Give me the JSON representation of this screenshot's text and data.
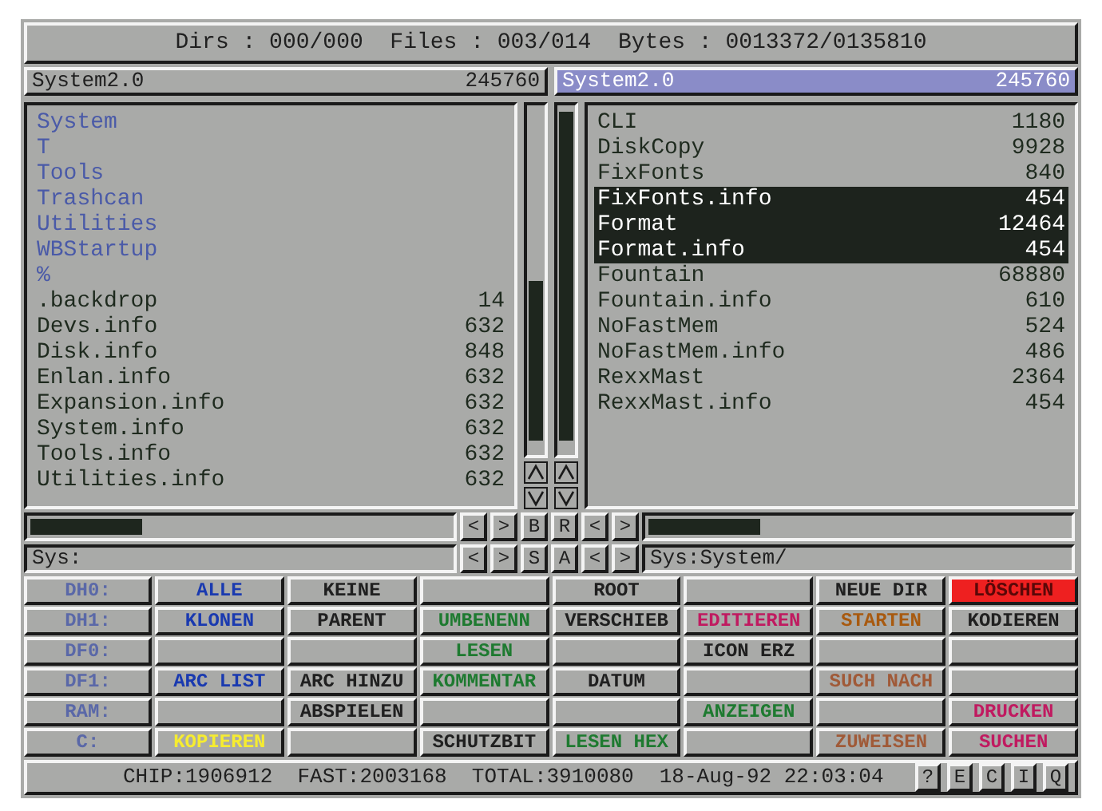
{
  "title_bar": "Dirs : 000/000  Files : 003/014  Bytes : 0013372/0135810",
  "panels": [
    {
      "title": "System2.0",
      "size": "245760",
      "active": false,
      "path": "Sys:",
      "entries": [
        {
          "name": "System",
          "kind": "dir",
          "selected": false
        },
        {
          "name": "T",
          "kind": "dir",
          "selected": false
        },
        {
          "name": "Tools",
          "kind": "dir",
          "selected": false
        },
        {
          "name": "Trashcan",
          "kind": "dir",
          "selected": false
        },
        {
          "name": "Utilities",
          "kind": "dir",
          "selected": false
        },
        {
          "name": "WBStartup",
          "kind": "dir",
          "selected": false
        },
        {
          "name": "%",
          "kind": "dir",
          "selected": false
        },
        {
          "name": ".backdrop",
          "size": "14",
          "kind": "file",
          "selected": false
        },
        {
          "name": "Devs.info",
          "size": "632",
          "kind": "file",
          "selected": false
        },
        {
          "name": "Disk.info",
          "size": "848",
          "kind": "file",
          "selected": false
        },
        {
          "name": "Enlan.info",
          "size": "632",
          "kind": "file",
          "selected": false
        },
        {
          "name": "Expansion.info",
          "size": "632",
          "kind": "file",
          "selected": false
        },
        {
          "name": "System.info",
          "size": "632",
          "kind": "file",
          "selected": false
        },
        {
          "name": "Tools.info",
          "size": "632",
          "kind": "file",
          "selected": false
        },
        {
          "name": "Utilities.info",
          "size": "632",
          "kind": "file",
          "selected": false
        }
      ]
    },
    {
      "title": "System2.0",
      "size": "245760",
      "active": true,
      "path": "Sys:System/",
      "entries": [
        {
          "name": "CLI",
          "size": "1180",
          "kind": "file",
          "selected": false
        },
        {
          "name": "DiskCopy",
          "size": "9928",
          "kind": "file",
          "selected": false
        },
        {
          "name": "FixFonts",
          "size": "840",
          "kind": "file",
          "selected": false
        },
        {
          "name": "FixFonts.info",
          "size": "454",
          "kind": "file",
          "selected": true
        },
        {
          "name": "Format",
          "size": "12464",
          "kind": "file",
          "selected": true
        },
        {
          "name": "Format.info",
          "size": "454",
          "kind": "file",
          "selected": true
        },
        {
          "name": "Fountain",
          "size": "68880",
          "kind": "file",
          "selected": false
        },
        {
          "name": "Fountain.info",
          "size": "610",
          "kind": "file",
          "selected": false
        },
        {
          "name": "NoFastMem",
          "size": "524",
          "kind": "file",
          "selected": false
        },
        {
          "name": "NoFastMem.info",
          "size": "486",
          "kind": "file",
          "selected": false
        },
        {
          "name": "RexxMast",
          "size": "2364",
          "kind": "file",
          "selected": false
        },
        {
          "name": "RexxMast.info",
          "size": "454",
          "kind": "file",
          "selected": false
        }
      ]
    }
  ],
  "nav_rows": [
    [
      "<",
      ">",
      "B",
      "R",
      "<",
      ">"
    ],
    [
      "<",
      ">",
      "S",
      "A",
      "<",
      ">"
    ]
  ],
  "button_rows": [
    [
      {
        "label": "DH0:",
        "color": "#5a68a8"
      },
      {
        "label": "ALLE",
        "color": "#1a3ab0"
      },
      {
        "label": "KEINE",
        "color": "#202020"
      },
      {
        "kind": "blank"
      },
      {
        "label": "ROOT",
        "color": "#202020"
      },
      {
        "kind": "blank"
      },
      {
        "label": "NEUE DIR",
        "color": "#202020"
      },
      {
        "label": "LÖSCHEN",
        "kind": "alert",
        "color": "#ee2020"
      }
    ],
    [
      {
        "label": "DH1:",
        "color": "#5a68a8"
      },
      {
        "label": "KLONEN",
        "color": "#1a3ab0"
      },
      {
        "label": "PARENT",
        "color": "#202020"
      },
      {
        "label": "UMBENENN",
        "color": "#1e7a30"
      },
      {
        "label": "VERSCHIEB",
        "color": "#202020"
      },
      {
        "label": "EDITIEREN",
        "color": "#c01a60"
      },
      {
        "label": "STARTEN",
        "color": "#a85a10"
      },
      {
        "label": "KODIEREN",
        "color": "#202020"
      }
    ],
    [
      {
        "label": "DF0:",
        "color": "#5a68a8"
      },
      {
        "kind": "blank"
      },
      {
        "kind": "blank"
      },
      {
        "label": "LESEN",
        "color": "#1e7a30"
      },
      {
        "kind": "blank"
      },
      {
        "label": "ICON ERZ",
        "color": "#202020"
      },
      {
        "kind": "blank"
      },
      {
        "kind": "blank"
      }
    ],
    [
      {
        "label": "DF1:",
        "color": "#5a68a8"
      },
      {
        "label": "ARC LIST",
        "color": "#1a3ab0"
      },
      {
        "label": "ARC HINZU",
        "color": "#202020"
      },
      {
        "label": "KOMMENTAR",
        "color": "#1e7a30"
      },
      {
        "label": "DATUM",
        "color": "#202020"
      },
      {
        "kind": "blank"
      },
      {
        "label": "SUCH NACH",
        "color": "#a05a38"
      },
      {
        "kind": "blank"
      }
    ],
    [
      {
        "label": "RAM:",
        "color": "#5a68a8"
      },
      {
        "kind": "blank"
      },
      {
        "label": "ABSPIELEN",
        "color": "#202020"
      },
      {
        "kind": "blank"
      },
      {
        "kind": "blank"
      },
      {
        "label": "ANZEIGEN",
        "color": "#1e7a30"
      },
      {
        "kind": "blank"
      },
      {
        "label": "DRUCKEN",
        "color": "#c01a60"
      }
    ],
    [
      {
        "label": "C:",
        "color": "#5a68a8"
      },
      {
        "label": "KOPIEREN",
        "color": "#f6ec30"
      },
      {
        "kind": "blank"
      },
      {
        "label": "SCHUTZBIT",
        "color": "#202020"
      },
      {
        "label": "LESEN HEX",
        "color": "#1e7a30"
      },
      {
        "kind": "blank"
      },
      {
        "label": "ZUWEISEN",
        "color": "#a05a38"
      },
      {
        "label": "SUCHEN",
        "color": "#c01a60"
      }
    ]
  ],
  "memory": "CHIP:1906912  FAST:2003168  TOTAL:3910080",
  "datetime": "18-Aug-92 22:03:04",
  "status_buttons": [
    "?",
    "E",
    "C",
    "I",
    "Q"
  ]
}
